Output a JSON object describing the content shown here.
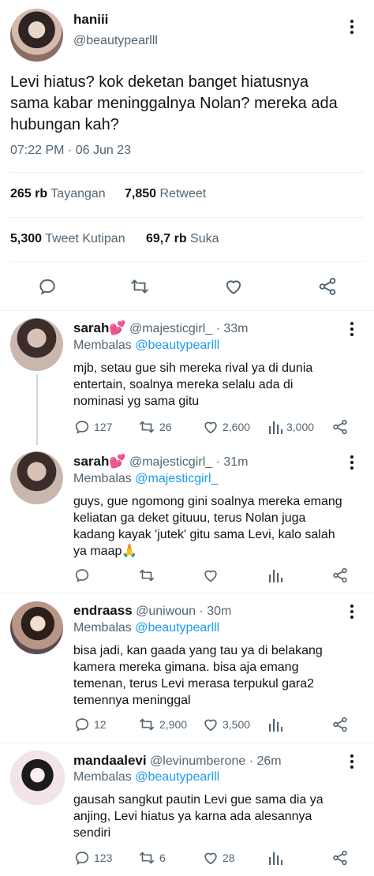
{
  "main_tweet": {
    "display_name": "haniii",
    "handle": "@beautypearlll",
    "text_lines": [
      "Levi hiatus? kok deketan banget hiatusnya",
      "sama kabar meninggalnya Nolan? mereka ada",
      "hubungan kah?"
    ],
    "timestamp": "07:22 PM · 06 Jun 23",
    "stats": {
      "views_num": "265 rb",
      "views_label": "Tayangan",
      "retweets_num": "7,850",
      "retweets_label": "Retweet",
      "quotes_num": "5,300",
      "quotes_label": "Tweet Kutipan",
      "likes_num": "69,7 rb",
      "likes_label": "Suka"
    }
  },
  "replies": [
    {
      "display_name": "sarah💕",
      "handle": "@majesticgirl_",
      "time": "· 33m",
      "replying_label": "Membalas",
      "replying_to": "@beautypearlll",
      "text_lines": [
        "mjb, setau gue sih mereka rival ya di dunia",
        "entertain, soalnya mereka selalu ada di",
        "nominasi yg sama gitu"
      ],
      "reply_count": "127",
      "retweet_count": "26",
      "like_count": "2,600",
      "view_count": "3,000"
    },
    {
      "display_name": "sarah💕",
      "handle": "@majesticgirl_",
      "time": "· 31m",
      "replying_label": "Membalas",
      "replying_to": "@majesticgirl_",
      "text_lines": [
        "guys, gue ngomong gini soalnya mereka emang",
        "keliatan ga deket gituuu, terus Nolan juga",
        "kadang kayak 'jutek' gitu sama Levi, kalo salah",
        "ya maap🙏"
      ],
      "reply_count": "",
      "retweet_count": "",
      "like_count": "",
      "view_count": ""
    },
    {
      "display_name": "endraass",
      "handle": "@uniwoun",
      "time": "· 30m",
      "replying_label": "Membalas",
      "replying_to": "@beautypearlll",
      "text_lines": [
        "bisa jadi, kan gaada yang tau ya di belakang",
        "kamera mereka gimana. bisa aja emang",
        "temenan, terus Levi merasa terpukul gara2",
        "temennya meninggal"
      ],
      "reply_count": "12",
      "retweet_count": "2,900",
      "like_count": "3,500",
      "view_count": ""
    },
    {
      "display_name": "mandaalevi",
      "handle": "@levinumberone",
      "time": "· 26m",
      "replying_label": "Membalas",
      "replying_to": "@beautypearlll",
      "text_lines": [
        "gausah sangkut pautin Levi gue sama dia ya",
        "anjing, Levi hiatus ya karna ada alesannya",
        "sendiri"
      ],
      "reply_count": "123",
      "retweet_count": "6",
      "like_count": "28",
      "view_count": ""
    }
  ],
  "icons": {
    "reply": "reply-icon",
    "retweet": "retweet-icon",
    "like": "heart-icon",
    "views": "views-icon",
    "share": "share-icon",
    "more": "more-icon"
  },
  "colors": {
    "link": "#1d9bf0",
    "muted": "#536471",
    "text": "#0f1419",
    "divider": "#eff3f4"
  }
}
